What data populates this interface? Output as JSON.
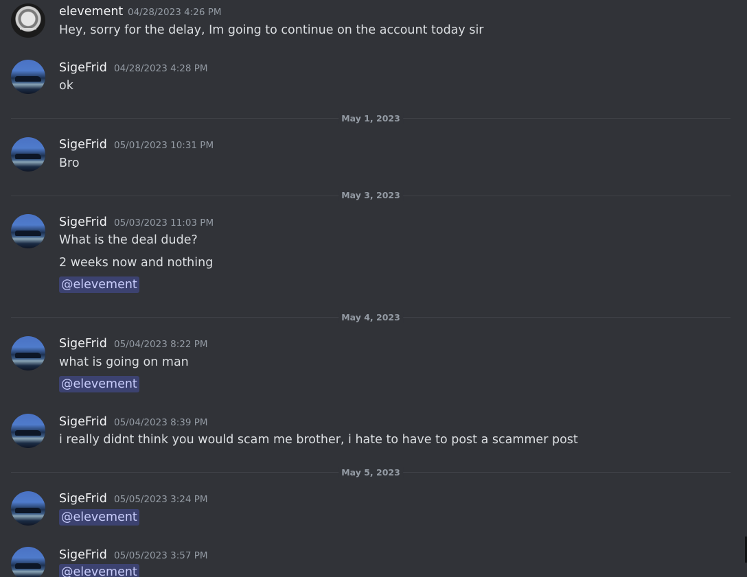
{
  "messages": [
    {
      "author": "elevement",
      "timestamp": "04/28/2023 4:26 PM",
      "lines": [
        "Hey, sorry for the delay, Im going to continue on the account today sir"
      ]
    },
    {
      "author": "SigeFrid",
      "timestamp": "04/28/2023 4:28 PM",
      "lines": [
        "ok"
      ]
    },
    {
      "author": "SigeFrid",
      "timestamp": "05/01/2023 10:31 PM",
      "lines": [
        "Bro"
      ]
    },
    {
      "author": "SigeFrid",
      "timestamp": "05/03/2023 11:03 PM",
      "lines": [
        "What is the deal dude?",
        "2 weeks now and nothing",
        "@elevement"
      ]
    },
    {
      "author": "SigeFrid",
      "timestamp": "05/04/2023 8:22 PM",
      "lines": [
        "what is going on man",
        "@elevement"
      ]
    },
    {
      "author": "SigeFrid",
      "timestamp": "05/04/2023 8:39 PM",
      "lines": [
        "i really didnt think you would scam me brother, i hate to have to post a scammer post"
      ]
    },
    {
      "author": "SigeFrid",
      "timestamp": "05/05/2023 3:24 PM",
      "lines": [
        "@elevement"
      ]
    },
    {
      "author": "SigeFrid",
      "timestamp": "05/05/2023 3:57 PM",
      "lines": [
        "@elevement"
      ]
    }
  ],
  "date_dividers": [
    "May 1, 2023",
    "May 3, 2023",
    "May 4, 2023",
    "May 5, 2023"
  ],
  "colors": {
    "background": "#313338",
    "username": "#f2f3f5",
    "message_text": "#dbdee1",
    "timestamp": "#949ba4",
    "mention_bg": "#3c4270",
    "mention_text": "#c9cdfb",
    "divider": "#3f4147"
  }
}
